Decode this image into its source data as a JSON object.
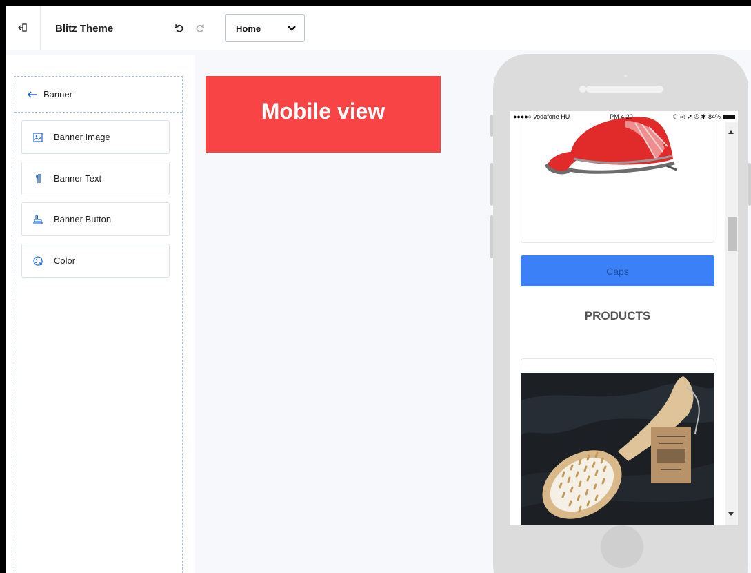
{
  "header": {
    "title": "Blitz Theme",
    "page_select": {
      "value": "Home",
      "options": [
        "Home"
      ]
    },
    "icons": {
      "exit": "exit-icon",
      "undo": "undo-icon",
      "redo": "redo-icon",
      "dropdown": "chevron-down-icon"
    }
  },
  "sidebar": {
    "back_label": "Banner",
    "items": [
      {
        "label": "Banner Image",
        "icon": "image-icon"
      },
      {
        "label": "Banner Text",
        "icon": "paragraph-icon"
      },
      {
        "label": "Banner Button",
        "icon": "button-icon"
      },
      {
        "label": "Color",
        "icon": "palette-icon"
      }
    ]
  },
  "banner": {
    "text": "Mobile view",
    "color": "#f94446"
  },
  "phone": {
    "status": {
      "carrier": "●●●●○ vodafone HU",
      "time": "PM 4:20",
      "battery": "84%"
    },
    "caps_button": "Caps",
    "products_heading": "PRODUCTS",
    "accent_color": "#3b80f7"
  }
}
